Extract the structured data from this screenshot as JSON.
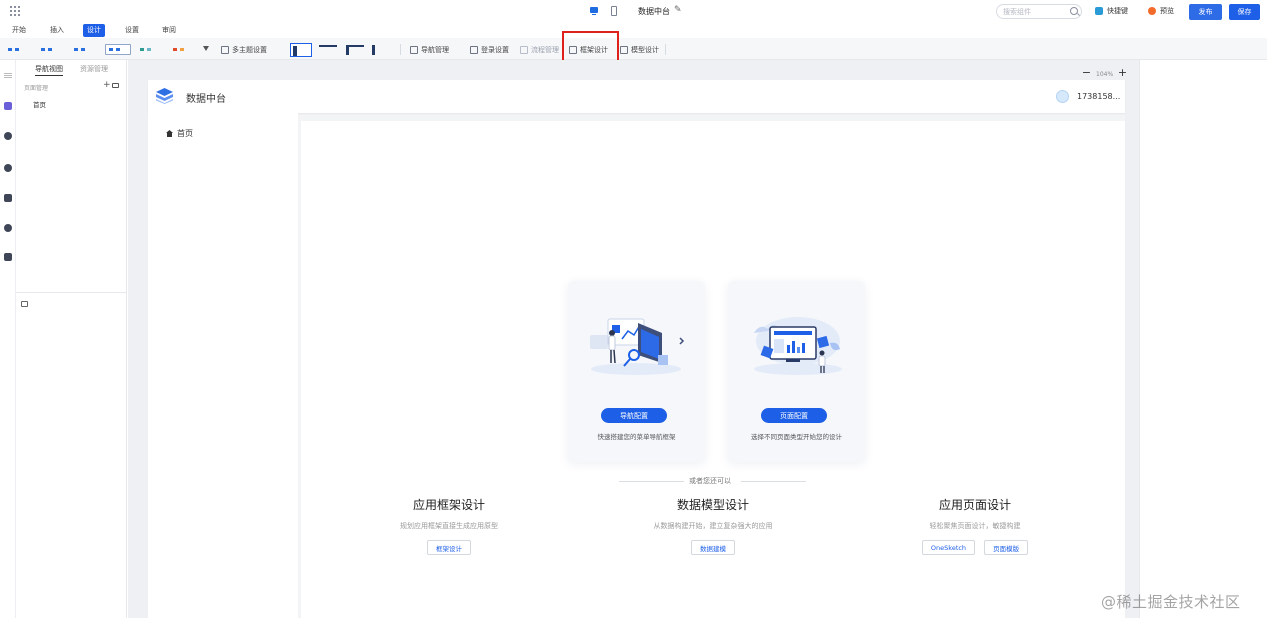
{
  "topbar": {
    "app_title": "数据中台",
    "search_placeholder": "搜索组件",
    "shortcut_label": "快捷键",
    "preview_label": "预览",
    "publish_label": "发布",
    "save_label": "保存"
  },
  "menu": {
    "tabs": [
      {
        "label": "开始"
      },
      {
        "label": "插入"
      },
      {
        "label": "设计",
        "active": true
      },
      {
        "label": "设置"
      },
      {
        "label": "审阅"
      }
    ]
  },
  "ribbon": {
    "multi_theme_label": "多主题设置",
    "nav_mgmt_label": "导航管理",
    "login_settings_label": "登录设置",
    "flow_mgmt_label": "流程管理",
    "frame_design_label": "框架设计",
    "model_design_label": "模型设计",
    "theme_swatches": [
      [
        "#2a6fe0",
        "#2a6fe0"
      ],
      [
        "#2a6fe0",
        "#2a6fe0"
      ],
      [
        "#2a6fe0",
        "#2a6fe0"
      ],
      [
        "#2a6fe0",
        "#2a6fe0"
      ],
      [
        "#2f9a8f",
        "#6bb7c7"
      ],
      [
        "#e04a2a",
        "#f0a040"
      ]
    ]
  },
  "left_panel": {
    "tabs": [
      {
        "label": "导航视图",
        "active": true
      },
      {
        "label": "资源管理"
      }
    ],
    "section_label": "页面管理",
    "pages": [
      {
        "label": "首页"
      }
    ]
  },
  "canvas": {
    "zoom_level": "104%",
    "app": {
      "name": "数据中台",
      "user": "1738158...",
      "sidebar_home": "首页",
      "cards": [
        {
          "button": "导航配置",
          "desc": "快速搭建您的菜单导航框架"
        },
        {
          "button": "页面配置",
          "desc": "选择不同页面类型开始您的设计"
        }
      ],
      "or_text": "或者您还可以",
      "features": [
        {
          "title": "应用框架设计",
          "desc": "规划应用框架直接生成应用原型",
          "buttons": [
            "框架设计"
          ]
        },
        {
          "title": "数据模型设计",
          "desc": "从数据构建开始，建立复杂强大的应用",
          "buttons": [
            "数据建模"
          ]
        },
        {
          "title": "应用页面设计",
          "desc": "轻松聚焦页面设计，敏捷构建",
          "buttons": [
            "OneSketch",
            "页面模版"
          ]
        }
      ]
    }
  },
  "colors": {
    "primary": "#1d5fe6",
    "highlight": "#e0201a"
  },
  "watermark": "@稀土掘金技术社区"
}
